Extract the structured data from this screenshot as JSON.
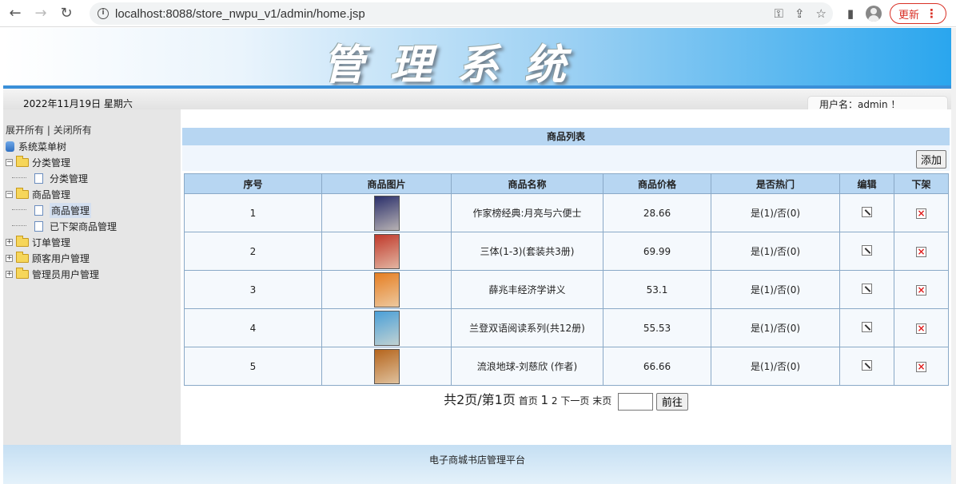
{
  "browser": {
    "url": "localhost:8088/store_nwpu_v1/admin/home.jsp",
    "update_label": "更新"
  },
  "header": {
    "title": "管理系统",
    "date": "2022年11月19日 星期六",
    "user": "用户名：admin ！"
  },
  "sidebar": {
    "expand_all": "展开所有",
    "separator": "|",
    "collapse_all": "关闭所有",
    "root": "系统菜单树",
    "groups": [
      {
        "label": "分类管理",
        "children": [
          "分类管理"
        ]
      },
      {
        "label": "商品管理",
        "children": [
          "商品管理",
          "已下架商品管理"
        ]
      },
      {
        "label": "订单管理",
        "children": []
      },
      {
        "label": "顾客用户管理",
        "children": []
      },
      {
        "label": "管理员用户管理",
        "children": []
      }
    ]
  },
  "main": {
    "list_title": "商品列表",
    "add_label": "添加",
    "columns": [
      "序号",
      "商品图片",
      "商品名称",
      "商品价格",
      "是否热门",
      "编辑",
      "下架"
    ],
    "rows": [
      {
        "no": "1",
        "name": "作家榜经典:月亮与六便士",
        "price": "28.66",
        "hot": "是(1)/否(0)",
        "cover": "#2a2f6b"
      },
      {
        "no": "2",
        "name": "三体(1-3)(套装共3册)",
        "price": "69.99",
        "hot": "是(1)/否(0)",
        "cover": "#c0392b"
      },
      {
        "no": "3",
        "name": "薛兆丰经济学讲义",
        "price": "53.1",
        "hot": "是(1)/否(0)",
        "cover": "#e67e22"
      },
      {
        "no": "4",
        "name": "兰登双语阅读系列(共12册)",
        "price": "55.53",
        "hot": "是(1)/否(0)",
        "cover": "#4a9fd8"
      },
      {
        "no": "5",
        "name": "流浪地球-刘慈欣 (作者)",
        "price": "66.66",
        "hot": "是(1)/否(0)",
        "cover": "#b5651d"
      }
    ],
    "pager": {
      "summary": "共2页/第1页",
      "first": "首页",
      "current": "1",
      "next_num": "2",
      "next": "下一页",
      "last": "末页",
      "go": "前往"
    }
  },
  "footer": {
    "text": "电子商城书店管理平台"
  }
}
